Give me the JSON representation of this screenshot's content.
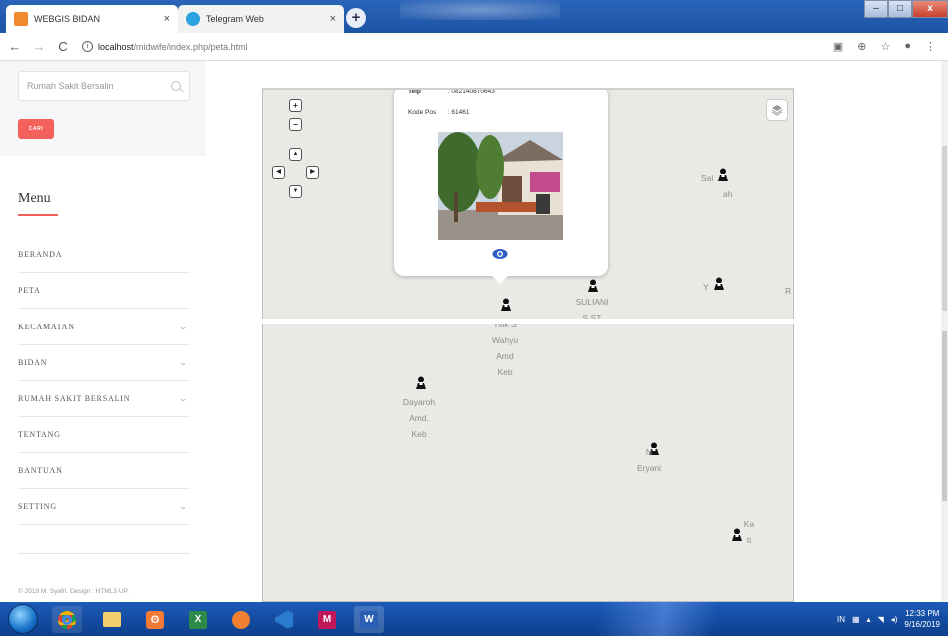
{
  "browser": {
    "tabs": [
      {
        "label": "WEBGIS BIDAN",
        "close": "×",
        "active": true
      },
      {
        "label": "Telegram Web",
        "close": "×",
        "active": false
      }
    ],
    "new_tab": "+",
    "url_host": "localhost",
    "url_path": "/midwife/index.php/peta.html",
    "info": "i",
    "window_buttons": [
      "–",
      "□",
      "x"
    ]
  },
  "sidebar": {
    "search_placeholder": "Rumah Sakit Bersalin",
    "search_button": "CARI",
    "menu_title": "Menu",
    "items": [
      {
        "label": "BERANDA",
        "has_submenu": false
      },
      {
        "label": "PETA",
        "has_submenu": false
      },
      {
        "label": "KECAMATAN",
        "has_submenu": true
      },
      {
        "label": "BIDAN",
        "has_submenu": true
      },
      {
        "label": "RUMAH SAKIT BERSALIN",
        "has_submenu": true
      },
      {
        "label": "TENTANG",
        "has_submenu": false
      },
      {
        "label": "BANTUAN",
        "has_submenu": false
      },
      {
        "label": "SETTING",
        "has_submenu": true
      }
    ],
    "chevron": "⌄",
    "footer": "© 2019 M. Syafri. Design : HTML5 UP."
  },
  "map": {
    "zoom_in": "+",
    "zoom_out": "−",
    "pan": {
      "up": "▲",
      "left": "◀",
      "right": "▶",
      "down": "▼"
    },
    "popup": {
      "telp_label": "Telp",
      "telp_value": ": 082140870643",
      "kodepos_label": "Kode Pos",
      "kodepos_value": ": 61461"
    },
    "markers": [
      {
        "lines": [
          "Sal",
          "ah"
        ]
      },
      {
        "lines": [
          "Y",
          ""
        ]
      },
      {
        "lines": [
          "R"
        ]
      },
      {
        "lines": [
          "SULIANI",
          "S.ST"
        ]
      },
      {
        "lines": [
          "Titik S",
          "Wahyu",
          "Amd",
          "Keb"
        ]
      },
      {
        "lines": [
          "Dayaroh",
          "Amd.",
          "Keb"
        ]
      },
      {
        "lines": [
          "N",
          "Eryani"
        ]
      },
      {
        "lines": [
          "Ka",
          "ti"
        ]
      }
    ]
  },
  "taskbar": {
    "tray_lang": "IN",
    "time": "12:33 PM",
    "date": "9/16/2019"
  },
  "colors": {
    "accent": "#f2615a",
    "map_bg": "#ebe9e6",
    "taskbar": "#1d5bb8"
  }
}
